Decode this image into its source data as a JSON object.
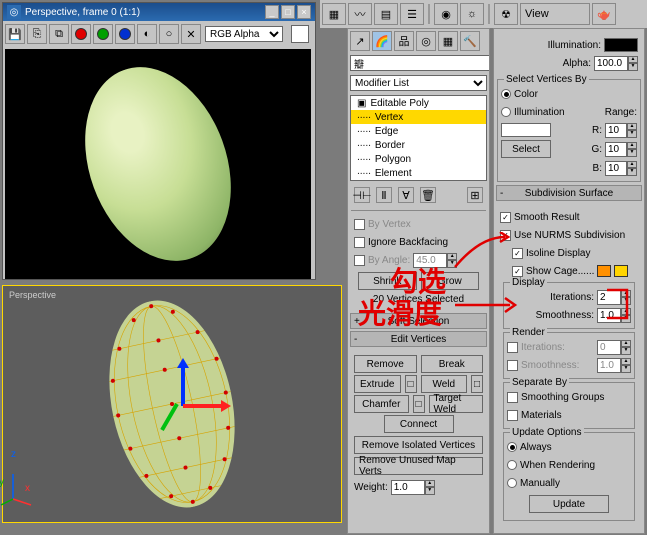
{
  "render_window": {
    "title": "Perspective, frame 0 (1:1)",
    "channel_select": "RGB Alpha"
  },
  "viewport": {
    "label": "Perspective"
  },
  "top_toolbar": {
    "view_btn": "View"
  },
  "modifier_panel": {
    "dropdown": "Modifier List",
    "stack": {
      "root": "Editable Poly",
      "levels": [
        "Vertex",
        "Edge",
        "Border",
        "Polygon",
        "Element"
      ]
    }
  },
  "selection": {
    "by_vertex": "By Vertex",
    "ignore_backfacing": "Ignore Backfacing",
    "by_angle": "By Angle:",
    "by_angle_val": "45.0",
    "shrink": "Shrink",
    "grow": "Grow",
    "status": "20 Vertices Selected"
  },
  "rollouts": {
    "soft_selection": "Soft Selection",
    "edit_vertices": "Edit Vertices"
  },
  "edit_vertices": {
    "remove": "Remove",
    "break": "Break",
    "extrude": "Extrude",
    "weld": "Weld",
    "chamfer": "Chamfer",
    "target_weld": "Target Weld",
    "connect": "Connect",
    "remove_iso": "Remove Isolated Vertices",
    "remove_unused": "Remove Unused Map Verts",
    "weight_label": "Weight:",
    "weight_val": "1.0"
  },
  "illum": {
    "label": "Illumination:",
    "alpha_label": "Alpha:",
    "alpha_val": "100.0"
  },
  "select_by": {
    "title": "Select Vertices By",
    "color": "Color",
    "illumination": "Illumination",
    "range": "Range:",
    "r": "R:",
    "r_val": "10",
    "g": "G:",
    "g_val": "10",
    "b": "B:",
    "b_val": "10",
    "select_btn": "Select"
  },
  "subdiv": {
    "title": "Subdivision Surface",
    "smooth_result": "Smooth Result",
    "use_nurms": "Use NURMS Subdivision",
    "isoline": "Isoline Display",
    "show_cage": "Show Cage......",
    "display_grp": "Display",
    "iterations": "Iterations:",
    "iterations_val": "2",
    "smoothness": "Smoothness:",
    "smoothness_val": "1.0",
    "render_grp": "Render",
    "r_iterations_val": "0",
    "r_smoothness_val": "1.0",
    "separate_by": "Separate By",
    "smoothing_groups": "Smoothing Groups",
    "materials": "Materials",
    "update_options": "Update Options",
    "always": "Always",
    "when_rendering": "When Rendering",
    "manually": "Manually",
    "update_btn": "Update"
  },
  "annotations": {
    "a1": "勾选",
    "a2": "光滑度"
  }
}
